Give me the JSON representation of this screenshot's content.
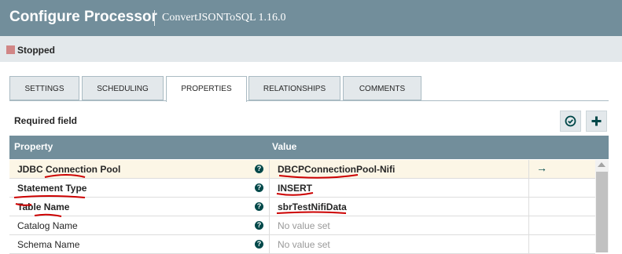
{
  "header": {
    "title": "Configure Processor",
    "subtitle": "ConvertJSONToSQL 1.16.0"
  },
  "status": {
    "label": "Stopped",
    "color": "#d18686"
  },
  "tabs": [
    {
      "label": "SETTINGS",
      "selected": false
    },
    {
      "label": "SCHEDULING",
      "selected": false
    },
    {
      "label": "PROPERTIES",
      "selected": true
    },
    {
      "label": "RELATIONSHIPS",
      "selected": false
    },
    {
      "label": "COMMENTS",
      "selected": false
    }
  ],
  "required_label": "Required field",
  "toolbar": {
    "verify_icon": "check-circle-icon",
    "add_icon": "plus-icon"
  },
  "table": {
    "columns": {
      "property": "Property",
      "value": "Value"
    },
    "rows": [
      {
        "property": "JDBC Connection Pool",
        "value": "DBCPConnectionPool-Nifi",
        "required": true,
        "has_link": true
      },
      {
        "property": "Statement Type",
        "value": "INSERT",
        "required": true
      },
      {
        "property": "Table Name",
        "value": "sbrTestNifiData",
        "required": true
      },
      {
        "property": "Catalog Name",
        "value": "No value set",
        "required": false
      },
      {
        "property": "Schema Name",
        "value": "No value set",
        "required": false
      }
    ]
  },
  "colors": {
    "header_bg": "#728e9b",
    "accent": "#004849",
    "highlight_row": "#fcf6e6",
    "annotation": "#cc0000"
  }
}
